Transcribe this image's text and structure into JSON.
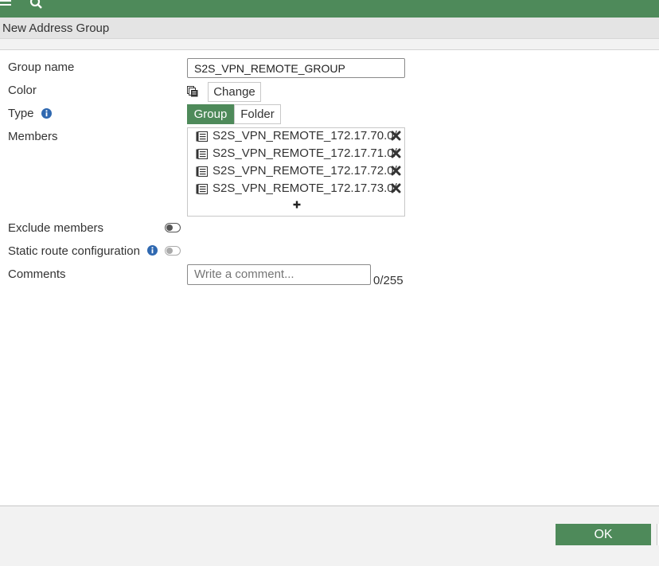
{
  "header": {
    "icons": [
      "menu-icon",
      "search-icon"
    ],
    "accent_color": "#4e8a5a"
  },
  "dialog": {
    "title": "New Address Group"
  },
  "form": {
    "group_name": {
      "label": "Group name",
      "value": "S2S_VPN_REMOTE_GROUP"
    },
    "color": {
      "label": "Color",
      "button_label": "Change",
      "icon": "color-palette-icon"
    },
    "type": {
      "label": "Type",
      "options": [
        "Group",
        "Folder"
      ],
      "selected": "Group"
    },
    "members": {
      "label": "Members",
      "items": [
        "S2S_VPN_REMOTE_172.17.70.0/",
        "S2S_VPN_REMOTE_172.17.71.0/",
        "S2S_VPN_REMOTE_172.17.72.0/",
        "S2S_VPN_REMOTE_172.17.73.0/"
      ],
      "add_symbol": "+"
    },
    "exclude_members": {
      "label": "Exclude members",
      "enabled": false
    },
    "static_route": {
      "label": "Static route configuration",
      "enabled": false
    },
    "comments": {
      "label": "Comments",
      "placeholder": "Write a comment...",
      "value": "",
      "counter": "0/255"
    }
  },
  "footer": {
    "ok_label": "OK"
  }
}
